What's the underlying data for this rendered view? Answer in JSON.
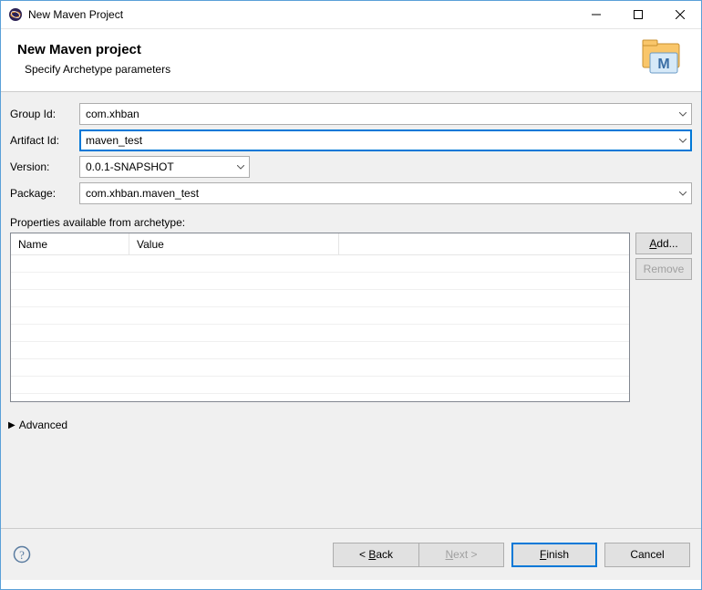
{
  "window": {
    "title": "New Maven Project"
  },
  "header": {
    "title": "New Maven project",
    "subtitle": "Specify Archetype parameters"
  },
  "form": {
    "groupIdLabel": "Group Id:",
    "groupIdValue": "com.xhban",
    "artifactIdLabel": "Artifact Id:",
    "artifactIdValue": "maven_test",
    "versionLabel": "Version:",
    "versionValue": "0.0.1-SNAPSHOT",
    "packageLabel": "Package:",
    "packageValue": "com.xhban.maven_test"
  },
  "properties": {
    "label": "Properties available from archetype:",
    "columns": {
      "name": "Name",
      "value": "Value"
    },
    "rows": []
  },
  "sideButtons": {
    "add": "Add...",
    "remove": "Remove"
  },
  "advanced": {
    "label": "Advanced"
  },
  "footer": {
    "back": "< Back",
    "next": "Next >",
    "finish": "Finish",
    "cancel": "Cancel"
  }
}
